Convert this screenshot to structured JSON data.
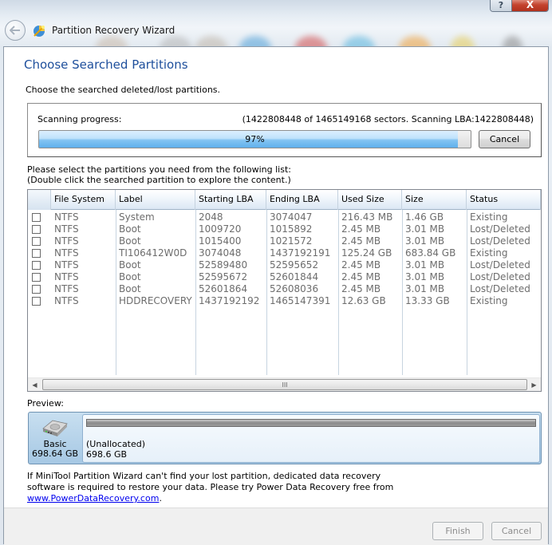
{
  "window": {
    "title": "Partition Recovery Wizard",
    "help_button": "?",
    "close_button": "X",
    "back_icon": "back-arrow-icon",
    "app_icon": "partition-wizard-icon"
  },
  "page": {
    "heading": "Choose Searched Partitions",
    "subheading": "Choose the searched deleted/lost partitions."
  },
  "scan": {
    "label": "Scanning progress:",
    "detail": "(1422808448 of 1465149168 sectors. Scanning LBA:1422808448)",
    "progress_percent": 97,
    "progress_text": "97%",
    "cancel_label": "Cancel"
  },
  "instructions": {
    "line1": "Please select the partitions you need from the following list:",
    "line2": "(Double click the searched partition to explore the content.)"
  },
  "table": {
    "columns": [
      "",
      "File System",
      "Label",
      "Starting LBA",
      "Ending LBA",
      "Used Size",
      "Size",
      "Status"
    ],
    "rows": [
      {
        "checked": false,
        "file_system": "NTFS",
        "label": "System",
        "starting_lba": "2048",
        "ending_lba": "3074047",
        "used_size": "216.43 MB",
        "size": "1.46 GB",
        "status": "Existing"
      },
      {
        "checked": false,
        "file_system": "NTFS",
        "label": "Boot",
        "starting_lba": "1009720",
        "ending_lba": "1015892",
        "used_size": "2.45 MB",
        "size": "3.01 MB",
        "status": "Lost/Deleted"
      },
      {
        "checked": false,
        "file_system": "NTFS",
        "label": "Boot",
        "starting_lba": "1015400",
        "ending_lba": "1021572",
        "used_size": "2.45 MB",
        "size": "3.01 MB",
        "status": "Lost/Deleted"
      },
      {
        "checked": false,
        "file_system": "NTFS",
        "label": "TI106412W0D",
        "starting_lba": "3074048",
        "ending_lba": "1437192191",
        "used_size": "125.24 GB",
        "size": "683.84 GB",
        "status": "Existing"
      },
      {
        "checked": false,
        "file_system": "NTFS",
        "label": "Boot",
        "starting_lba": "52589480",
        "ending_lba": "52595652",
        "used_size": "2.45 MB",
        "size": "3.01 MB",
        "status": "Lost/Deleted"
      },
      {
        "checked": false,
        "file_system": "NTFS",
        "label": "Boot",
        "starting_lba": "52595672",
        "ending_lba": "52601844",
        "used_size": "2.45 MB",
        "size": "3.01 MB",
        "status": "Lost/Deleted"
      },
      {
        "checked": false,
        "file_system": "NTFS",
        "label": "Boot",
        "starting_lba": "52601864",
        "ending_lba": "52608036",
        "used_size": "2.45 MB",
        "size": "3.01 MB",
        "status": "Lost/Deleted"
      },
      {
        "checked": false,
        "file_system": "NTFS",
        "label": "HDDRECOVERY",
        "starting_lba": "1437192192",
        "ending_lba": "1465147391",
        "used_size": "12.63 GB",
        "size": "13.33 GB",
        "status": "Existing"
      }
    ],
    "scrollbar_grip": "III"
  },
  "preview": {
    "label": "Preview:",
    "disk_type": "Basic",
    "disk_size": "698.64 GB",
    "partition_name": "(Unallocated)",
    "partition_size": "698.6 GB"
  },
  "note": {
    "text_line1": "If MiniTool Partition Wizard can't find your lost partition, dedicated data recovery",
    "text_line2": "software is required to restore your data. Please try Power Data Recovery free from",
    "link": "www.PowerDataRecovery.com",
    "after_link": "."
  },
  "footer": {
    "finish_label": "Finish",
    "cancel_label": "Cancel"
  }
}
